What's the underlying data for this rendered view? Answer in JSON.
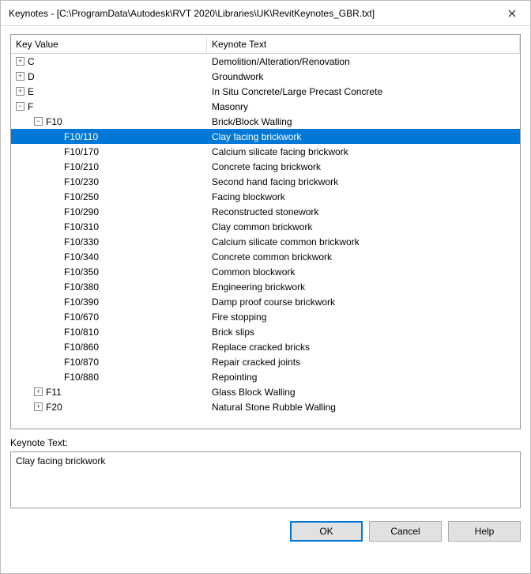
{
  "title": "Keynotes - [C:\\ProgramData\\Autodesk\\RVT 2020\\Libraries\\UK\\RevitKeynotes_GBR.txt]",
  "columns": {
    "key": "Key Value",
    "text": "Keynote Text"
  },
  "tree": [
    {
      "level": 0,
      "expand": "+",
      "key": "C",
      "text": "Demolition/Alteration/Renovation"
    },
    {
      "level": 0,
      "expand": "+",
      "key": "D",
      "text": "Groundwork"
    },
    {
      "level": 0,
      "expand": "+",
      "key": "E",
      "text": "In Situ Concrete/Large Precast Concrete"
    },
    {
      "level": 0,
      "expand": "-",
      "key": "F",
      "text": "Masonry"
    },
    {
      "level": 1,
      "expand": "-",
      "key": "F10",
      "text": "Brick/Block Walling"
    },
    {
      "level": 2,
      "expand": "",
      "key": "F10/110",
      "text": "Clay facing brickwork",
      "selected": true
    },
    {
      "level": 2,
      "expand": "",
      "key": "F10/170",
      "text": "Calcium silicate facing brickwork"
    },
    {
      "level": 2,
      "expand": "",
      "key": "F10/210",
      "text": "Concrete facing brickwork"
    },
    {
      "level": 2,
      "expand": "",
      "key": "F10/230",
      "text": "Second hand facing brickwork"
    },
    {
      "level": 2,
      "expand": "",
      "key": "F10/250",
      "text": "Facing blockwork"
    },
    {
      "level": 2,
      "expand": "",
      "key": "F10/290",
      "text": "Reconstructed stonework"
    },
    {
      "level": 2,
      "expand": "",
      "key": "F10/310",
      "text": "Clay common brickwork"
    },
    {
      "level": 2,
      "expand": "",
      "key": "F10/330",
      "text": "Calcium silicate common brickwork"
    },
    {
      "level": 2,
      "expand": "",
      "key": "F10/340",
      "text": "Concrete common brickwork"
    },
    {
      "level": 2,
      "expand": "",
      "key": "F10/350",
      "text": "Common blockwork"
    },
    {
      "level": 2,
      "expand": "",
      "key": "F10/380",
      "text": "Engineering brickwork"
    },
    {
      "level": 2,
      "expand": "",
      "key": "F10/390",
      "text": "Damp proof course brickwork"
    },
    {
      "level": 2,
      "expand": "",
      "key": "F10/670",
      "text": "Fire stopping"
    },
    {
      "level": 2,
      "expand": "",
      "key": "F10/810",
      "text": "Brick slips"
    },
    {
      "level": 2,
      "expand": "",
      "key": "F10/860",
      "text": "Replace cracked bricks"
    },
    {
      "level": 2,
      "expand": "",
      "key": "F10/870",
      "text": "Repair cracked joints"
    },
    {
      "level": 2,
      "expand": "",
      "key": "F10/880",
      "text": "Repointing"
    },
    {
      "level": 1,
      "expand": "+",
      "key": "F11",
      "text": "Glass Block Walling"
    },
    {
      "level": 1,
      "expand": "+",
      "key": "F20",
      "text": "Natural Stone Rubble Walling"
    }
  ],
  "keynote_label": "Keynote Text:",
  "keynote_value": "Clay facing brickwork",
  "buttons": {
    "ok": "OK",
    "cancel": "Cancel",
    "help": "Help"
  }
}
